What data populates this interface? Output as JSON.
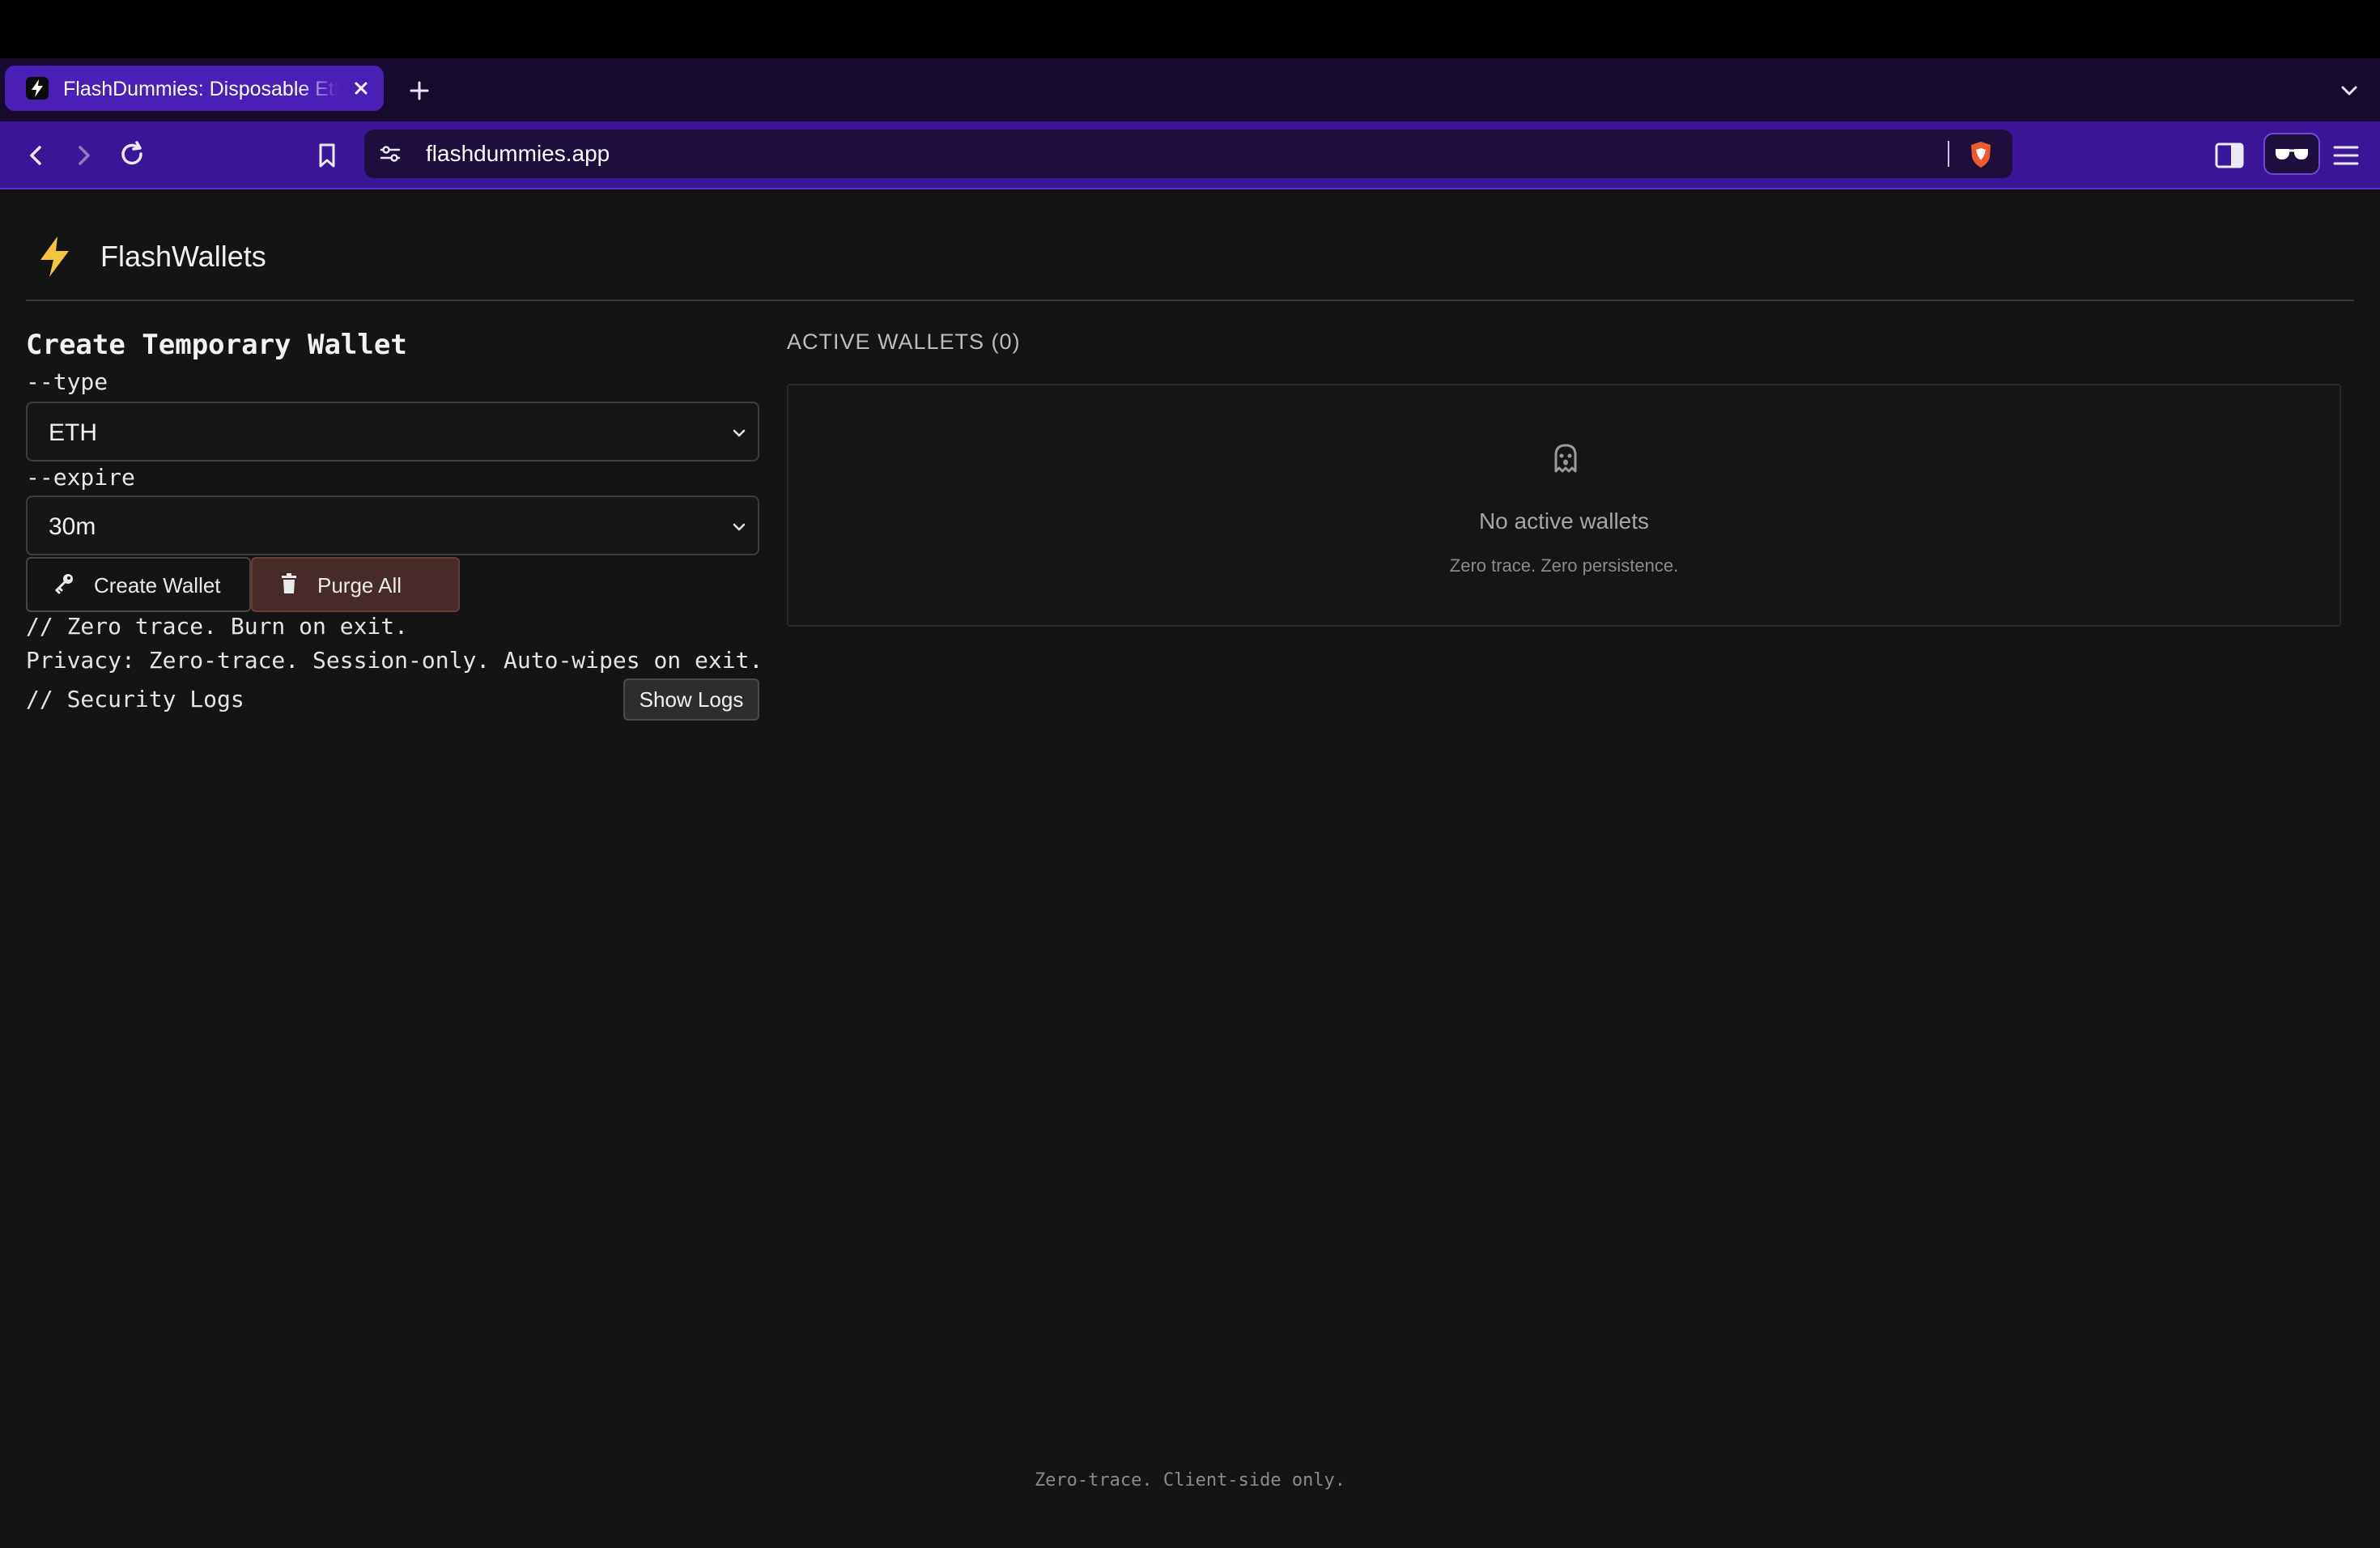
{
  "browser": {
    "tab_title": "FlashDummies: Disposable Ethereum Wallets",
    "url": "flashdummies.app",
    "accent_color": "#4a1fb5",
    "toolbar_color": "#3a1596"
  },
  "app": {
    "title": "FlashWallets",
    "logo_color": "#f5c542"
  },
  "create_panel": {
    "heading": "Create Temporary Wallet",
    "type_label": "--type",
    "type_value": "ETH",
    "expire_label": "--expire",
    "expire_value": "30m",
    "create_button": "Create Wallet",
    "purge_button": "Purge All",
    "note_trace": "// Zero trace. Burn on exit.",
    "note_privacy": "Privacy: Zero-trace. Session-only. Auto-wipes on exit.",
    "logs_label": "// Security Logs",
    "logs_button": "Show Logs"
  },
  "wallets_panel": {
    "header": "ACTIVE WALLETS (0)",
    "empty_title": "No active wallets",
    "empty_subtitle": "Zero trace. Zero persistence."
  },
  "footer": {
    "text": "Zero-trace. Client-side only."
  },
  "icons": {
    "back": "chevron-left-icon",
    "forward": "chevron-right-icon",
    "reload": "reload-icon",
    "bookmark": "bookmark-icon",
    "site_settings": "tune-icon",
    "shield": "brave-shield-icon",
    "sidebar": "sidebar-icon",
    "reader": "sunglasses-icon",
    "menu": "hamburger-icon",
    "key": "key-icon",
    "trash": "trash-icon",
    "ghost": "ghost-icon"
  }
}
